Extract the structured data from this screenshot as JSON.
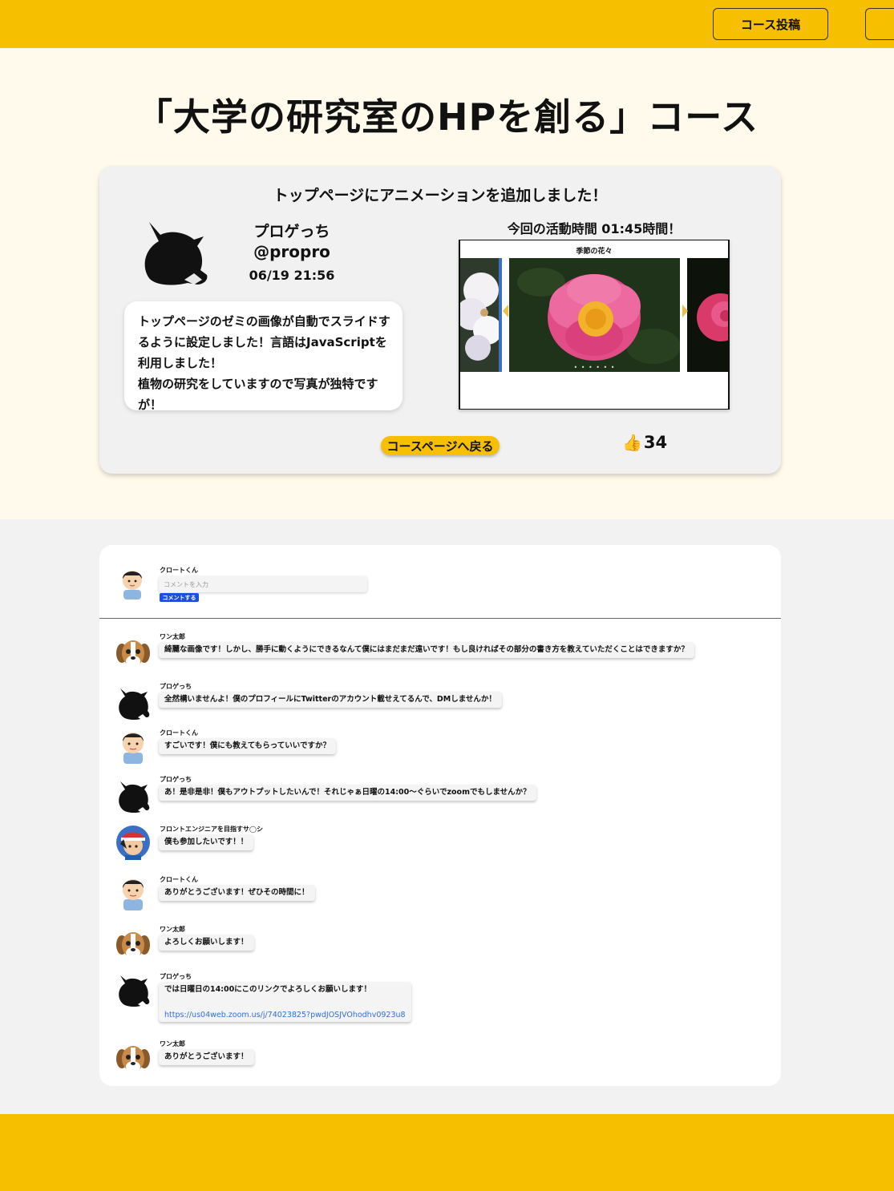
{
  "header": {
    "post_course_label": "コース投稿",
    "second_button_label": ""
  },
  "course": {
    "title": "「大学の研究室のHPを創る」コース"
  },
  "post": {
    "headline": "トップページにアニメーションを追加しました！",
    "author_name": "プロゲっち",
    "author_handle": "@propro",
    "date": "06/19 21:56",
    "body_lines": [
      "トップページのゼミの画像が自動でスライドす",
      "るように設定しました！言語はJavaScriptを",
      "利用しました！",
      "植物の研究をしていますので写真が独特ですが！"
    ],
    "activity_time": "今回の活動時間  01:45時間！",
    "slider_title": "季節の花々",
    "slider_dots": "• • • • • •",
    "back_button": "コースページへ戻る",
    "like_icon": "👍",
    "like_count": "34"
  },
  "compose": {
    "user_name": "クロートくん",
    "placeholder": "コメントを入力",
    "submit_label": "コメントする"
  },
  "comments": [
    {
      "name": "ワン太郎",
      "avatar": "dog-avatar",
      "text": "綺麗な画像です！しかし、勝手に動くようにできるなんて僕にはまだまだ遠いです！もし良ければその部分の書き方を教えていただくことはできますか？"
    },
    {
      "name": "プロゲっち",
      "avatar": "cat-avatar",
      "text": "全然構いませんよ！僕のプロフィールにTwitterのアカウント載せえてるんで、DMしませんか！"
    },
    {
      "name": "クロートくん",
      "avatar": "boy-avatar",
      "text": "すごいです！僕にも教えてもらっていいですか？"
    },
    {
      "name": "プロゲっち",
      "avatar": "cat-avatar",
      "text": "あ！是非是非！僕もアウトプットしたいんで！それじゃぁ日曜の14:00〜ぐらいでzoomでもしませんか？"
    },
    {
      "name": "フロントエンジニアを目指すサ◯シ",
      "avatar": "cap-boy-avatar",
      "text": "僕も参加したいです！！"
    },
    {
      "name": "クロートくん",
      "avatar": "boy-avatar",
      "text": "ありがとうございます！ぜひその時間に！"
    },
    {
      "name": "ワン太郎",
      "avatar": "dog-avatar",
      "text": "よろしくお願いします！"
    },
    {
      "name": "プロゲっち",
      "avatar": "cat-avatar",
      "text": "では日曜日の14:00にこのリンクでよろしくお願いします！",
      "link": "https://us04web.zoom.us/j/74023825?pwdJOSJVOhodhv0923u8"
    },
    {
      "name": "ワン太郎",
      "avatar": "dog-avatar",
      "text": "ありがとうございます！"
    }
  ],
  "colors": {
    "brand_yellow": "#f6bf00",
    "hero_bg": "#fffaeb",
    "page_bg": "#f2f2f2",
    "submit_blue": "#1a4fe0",
    "link_blue": "#2f6ed8"
  }
}
